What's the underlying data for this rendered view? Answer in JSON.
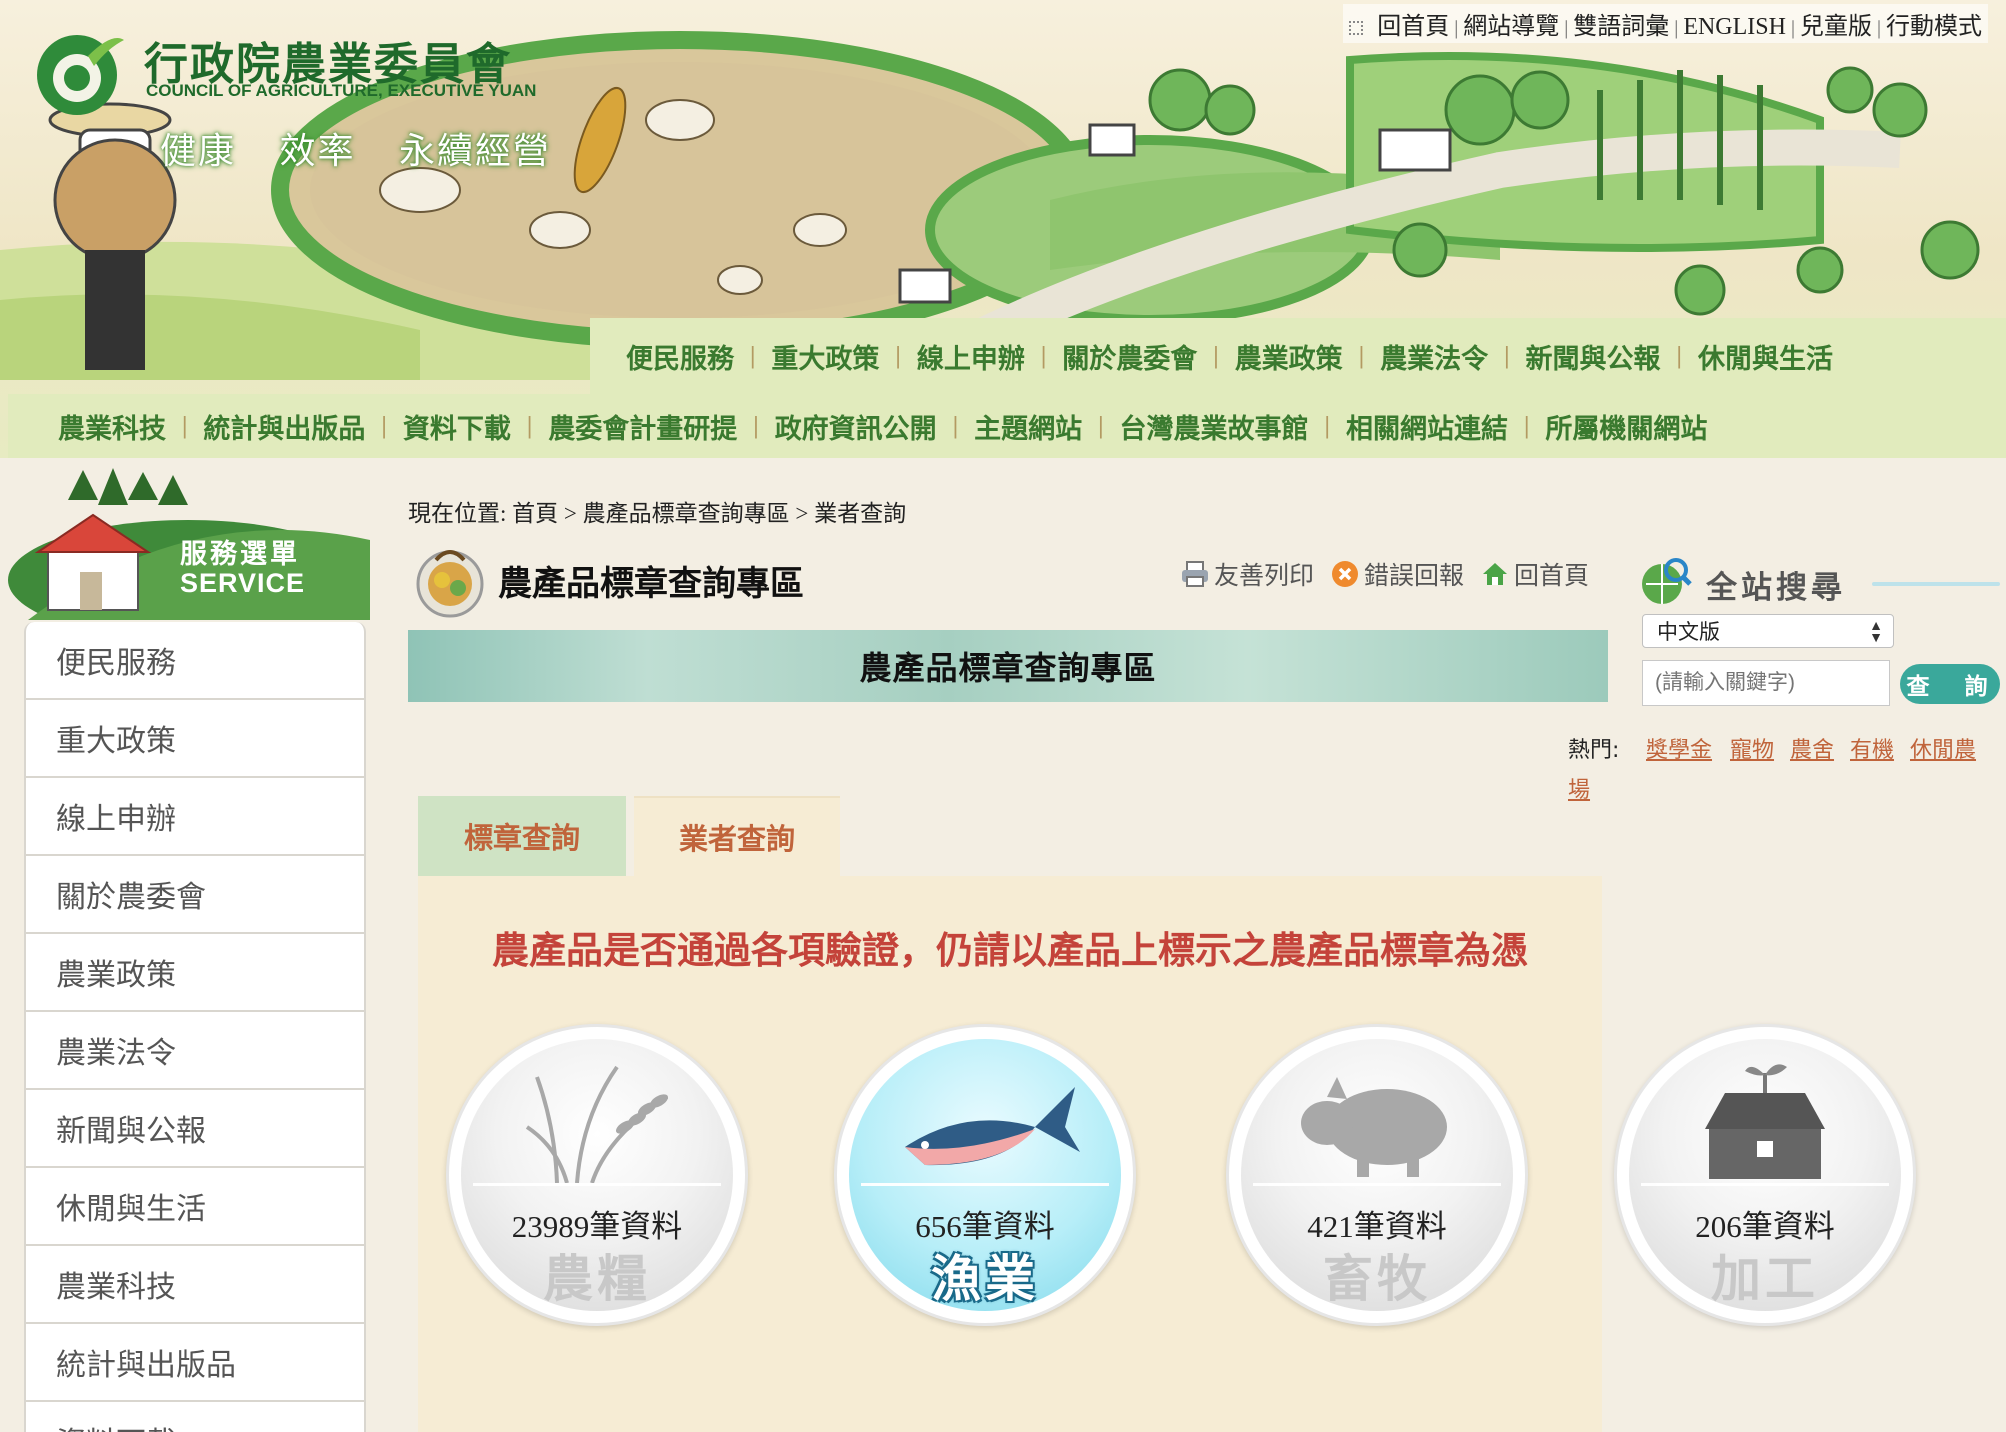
{
  "header": {
    "logo_zh": "行政院農業委員會",
    "logo_en": "COUNCIL OF AGRICULTURE, EXECUTIVE YUAN",
    "slogans": [
      "健康",
      "效率",
      "永續經營"
    ],
    "utility_links": [
      "回首頁",
      "網站導覽",
      "雙語詞彙",
      "ENGLISH",
      "兒童版",
      "行動模式"
    ],
    "main_nav_row1": [
      "便民服務",
      "重大政策",
      "線上申辦",
      "關於農委會",
      "農業政策",
      "農業法令",
      "新聞與公報",
      "休閒與生活"
    ],
    "main_nav_row2": [
      "農業科技",
      "統計與出版品",
      "資料下載",
      "農委會計畫研提",
      "政府資訊公開",
      "主題網站",
      "台灣農業故事館",
      "相關網站連結",
      "所屬機關網站"
    ]
  },
  "sidebar": {
    "banner_zh": "服務選單",
    "banner_en": "SERVICE",
    "items": [
      "便民服務",
      "重大政策",
      "線上申辦",
      "關於農委會",
      "農業政策",
      "農業法令",
      "新聞與公報",
      "休閒與生活",
      "農業科技",
      "統計與出版品",
      "資料下載"
    ]
  },
  "breadcrumb": {
    "prefix": "現在位置:",
    "items": [
      "首頁",
      "農產品標章查詢專區",
      "業者查詢"
    ],
    "separator": ">"
  },
  "page": {
    "title": "農產品標章查詢專區",
    "title_bar": "農產品標章查詢專區",
    "tools": [
      "友善列印",
      "錯誤回報",
      "回首頁"
    ]
  },
  "tabs": [
    "標章查詢",
    "業者查詢"
  ],
  "notice": "農產品是否通過各項驗證，仍請以產品上標示之農產品標章為憑",
  "categories": [
    {
      "count": "23989筆資料",
      "name": "農糧",
      "icon": "rice-stalk-icon",
      "active": false
    },
    {
      "count": "656筆資料",
      "name": "漁業",
      "icon": "fish-icon",
      "active": true
    },
    {
      "count": "421筆資料",
      "name": "畜牧",
      "icon": "pig-icon",
      "active": false
    },
    {
      "count": "206筆資料",
      "name": "加工",
      "icon": "factory-house-icon",
      "active": false
    }
  ],
  "search": {
    "title": "全站搜尋",
    "language": "中文版",
    "placeholder": "(請輸入關鍵字)",
    "button": "查　詢",
    "hot_label": "熱門:",
    "hot_links": [
      "獎學金",
      "寵物",
      "農舍",
      "有機",
      "休閒農",
      "場"
    ]
  },
  "colors": {
    "nav_green": "#3a7a2f",
    "nav_bg": "#e1ebbd",
    "tab_text": "#c0643b",
    "notice_red": "#c4433a",
    "search_button": "#3aa89b",
    "panel_bg": "#f6ecd4"
  }
}
